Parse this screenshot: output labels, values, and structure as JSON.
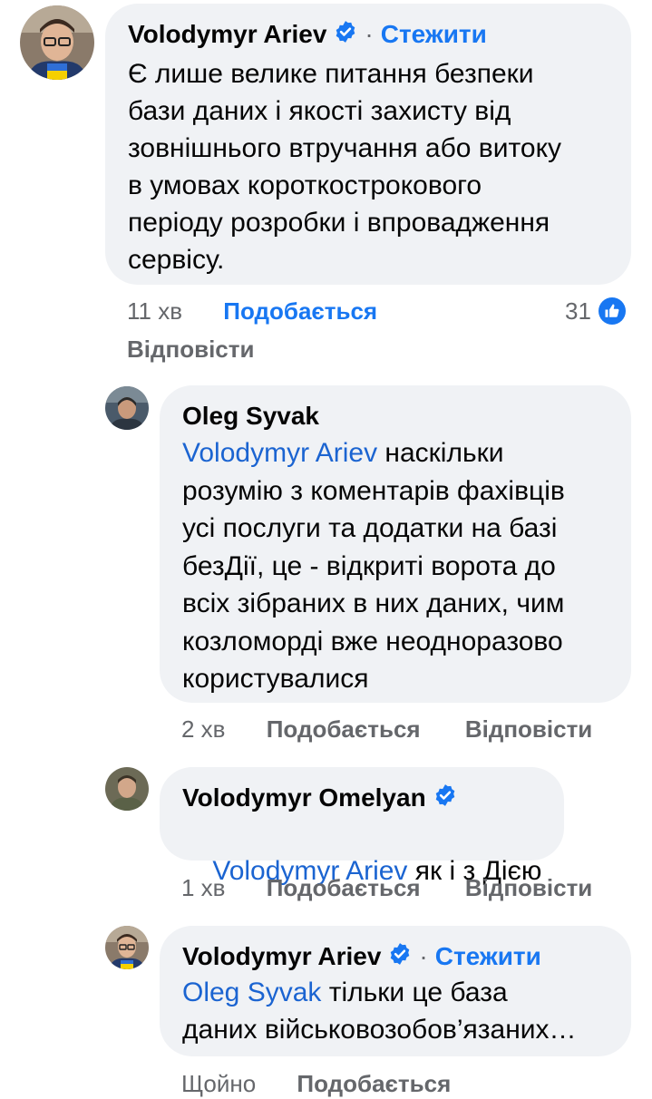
{
  "comments": [
    {
      "author": "Volodymyr Ariev",
      "verified": true,
      "follow_label": "Стежити",
      "text": "Є лише велике питання безпеки\nбази даних і якості захисту від\nзовнішнього втручання або витоку\nв умовах короткострокового\nперіоду розробки і впровадження\nсервісу.",
      "time": "11 хв",
      "like_label": "Подобається",
      "reply_label": "Відповісти",
      "reaction_count": "31"
    },
    {
      "author": "Oleg Syvak",
      "verified": false,
      "mention": "Volodymyr Ariev",
      "text_first": " наскільки",
      "text_rest": "розумію з коментарів фахівців\nусі послуги та додатки на базі\nбезДії, це - відкриті ворота до\nвсіх зібраних в них даних, чим\nкозломорді вже неодноразово\nкористувалися",
      "time": "2 хв",
      "like_label": "Подобається",
      "reply_label": "Відповісти"
    },
    {
      "author": "Volodymyr Omelyan",
      "verified": true,
      "mention": "Volodymyr Ariev",
      "text": " як і з Дією",
      "time": "1 хв",
      "like_label": "Подобається",
      "reply_label": "Відповісти"
    },
    {
      "author": "Volodymyr Ariev",
      "verified": true,
      "follow_label": "Стежити",
      "mention": "Oleg Syvak",
      "text_first": " тільки це база",
      "text_rest": "даних військовозобов’язаних…",
      "time": "Щойно",
      "like_label": "Подобається"
    }
  ],
  "colors": {
    "bubble": "#f0f2f5",
    "link_blue": "#1877f2",
    "mention_blue": "#1b64d1",
    "meta_gray": "#65676b"
  },
  "icons": [
    "verified-badge-icon",
    "like-reaction-icon"
  ]
}
